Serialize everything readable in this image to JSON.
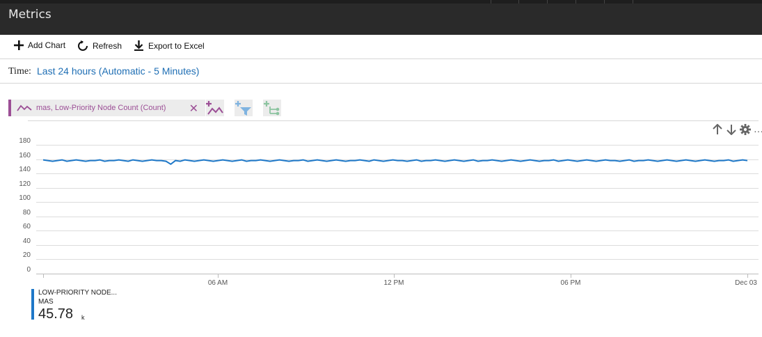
{
  "blade": {
    "title": "Metrics"
  },
  "toolbar": {
    "add_chart": "Add Chart",
    "refresh": "Refresh",
    "export": "Export to Excel"
  },
  "time": {
    "label": "Time:",
    "value": "Last 24 hours (Automatic - 5 Minutes)"
  },
  "metric_chip": {
    "label": "mas, Low-Priority Node Count (Count)",
    "color": "#9c4f96"
  },
  "icons": [
    "line-chart-add-icon",
    "filter-add-icon",
    "split-add-icon",
    "arrow-up-icon",
    "arrow-down-icon",
    "gear-icon",
    "more-icon"
  ],
  "legend": {
    "name": "LOW-PRIORITY NODE...",
    "sub": "MAS",
    "value": "45.78",
    "unit": "k",
    "color": "#1e78c8"
  },
  "chart_data": {
    "type": "line",
    "y_ticks": [
      "180",
      "160",
      "140",
      "120",
      "100",
      "80",
      "60",
      "40",
      "20",
      "0"
    ],
    "ylim": [
      0,
      180
    ],
    "x_ticks": [
      "06 AM",
      "12 PM",
      "06 PM",
      "Dec 03"
    ],
    "grid": true,
    "series": [
      {
        "name": "LOW-PRIORITY NODE... MAS",
        "color": "#1e78c8",
        "values": [
          159,
          158,
          157,
          158,
          159,
          157,
          158,
          159,
          158,
          157,
          158,
          158,
          159,
          157,
          158,
          158,
          159,
          158,
          157,
          159,
          158,
          157,
          158,
          159,
          158,
          158,
          157,
          153,
          158,
          157,
          159,
          158,
          157,
          158,
          159,
          158,
          157,
          158,
          159,
          158,
          157,
          158,
          159,
          157,
          158,
          158,
          159,
          158,
          157,
          158,
          159,
          158,
          157,
          158,
          158,
          159,
          157,
          158,
          159,
          158,
          157,
          158,
          159,
          158,
          157,
          158,
          158,
          159,
          158,
          157,
          159,
          158,
          157,
          158,
          159,
          158,
          158,
          157,
          158,
          159,
          157,
          158,
          158,
          159,
          158,
          157,
          158,
          159,
          158,
          157,
          158,
          159,
          157,
          158,
          158,
          159,
          158,
          157,
          158,
          159,
          158,
          157,
          158,
          159,
          158,
          157,
          158,
          158,
          159,
          157,
          158,
          159,
          158,
          157,
          158,
          159,
          158,
          157,
          158,
          159,
          158,
          158,
          157,
          158,
          159,
          157,
          158,
          158,
          159,
          158,
          157,
          158,
          159,
          158,
          157,
          158,
          159,
          158,
          157,
          158,
          159,
          158,
          157,
          158,
          158,
          159,
          157,
          158,
          159,
          158
        ]
      }
    ]
  }
}
